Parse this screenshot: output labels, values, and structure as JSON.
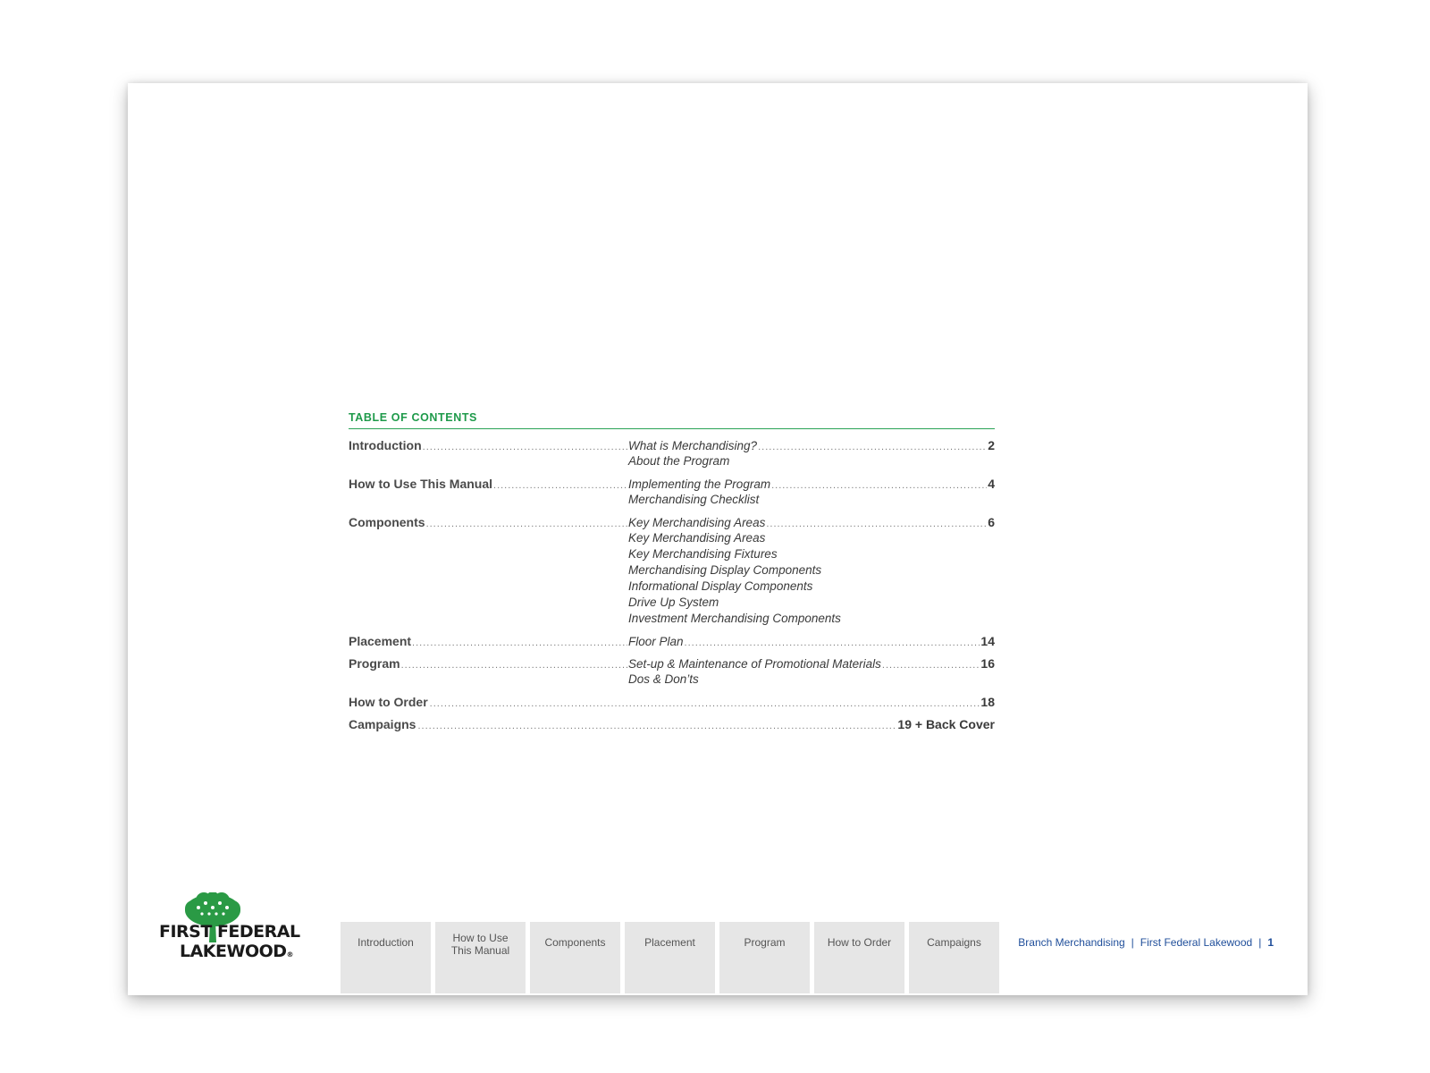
{
  "toc": {
    "heading": "TABLE OF CONTENTS",
    "entries": [
      {
        "title": "Introduction",
        "first_sub": "What is Merchandising?",
        "page": "2",
        "more_subs": [
          "About the Program"
        ]
      },
      {
        "title": "How to Use This Manual",
        "first_sub": "Implementing the Program",
        "page": "4",
        "more_subs": [
          "Merchandising Checklist"
        ]
      },
      {
        "title": "Components",
        "first_sub": "Key Merchandising Areas",
        "page": "6",
        "more_subs": [
          "Key Merchandising Areas",
          "Key Merchandising Fixtures",
          "Merchandising Display Components",
          "Informational Display Components",
          "Drive Up System",
          "Investment Merchandising Components"
        ]
      },
      {
        "title": "Placement",
        "first_sub": "Floor Plan",
        "page": "14",
        "more_subs": []
      },
      {
        "title": "Program",
        "first_sub": "Set-up & Maintenance of Promotional Materials",
        "page": "16",
        "more_subs": [
          "Dos & Don’ts"
        ]
      },
      {
        "title": "How to Order",
        "page": "18"
      },
      {
        "title": "Campaigns",
        "page": "19 + Back Cover"
      }
    ]
  },
  "logo": {
    "line1": "FIRST FEDERAL",
    "line2": "LAKEWOOD",
    "reg": "®",
    "color": "#2a9a45"
  },
  "nav_tabs": [
    {
      "line1": "Introduction"
    },
    {
      "line1": "How to Use",
      "line2": "This Manual"
    },
    {
      "line1": "Components"
    },
    {
      "line1": "Placement"
    },
    {
      "line1": "Program"
    },
    {
      "line1": "How to Order"
    },
    {
      "line1": "Campaigns"
    }
  ],
  "footer": {
    "section": "Branch Merchandising",
    "org": "First Federal Lakewood",
    "separator": "|",
    "page_number": "1"
  },
  "colors": {
    "heading_green": "#1e9a4a",
    "footer_blue": "#1f4e9a",
    "tab_gray": "#e6e6e6"
  }
}
